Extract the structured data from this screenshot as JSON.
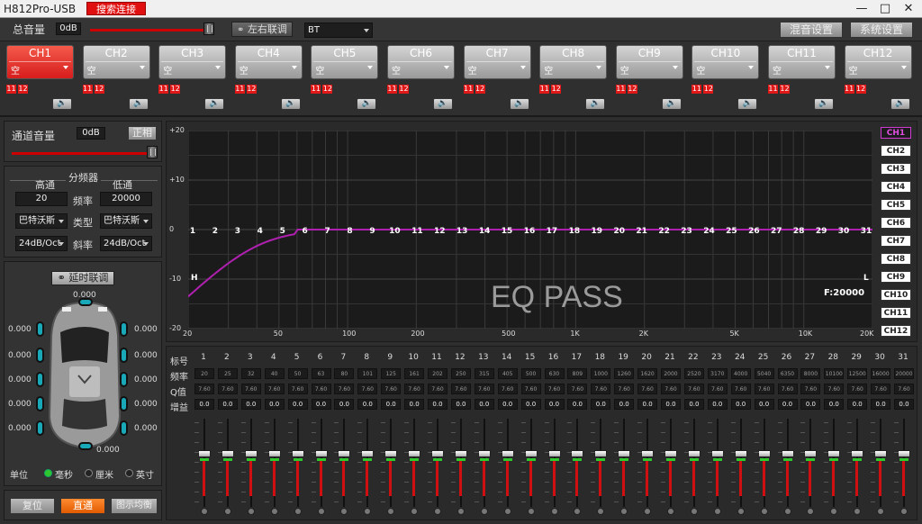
{
  "window": {
    "title": "H812Pro-USB",
    "connect_label": "搜索连接",
    "minimize": "—",
    "maximize": "□",
    "close": "✕"
  },
  "top": {
    "master_label": "总音量",
    "master_value": "0dB",
    "link_label": "左右联调",
    "source_value": "BT",
    "mix_label": "混音设置",
    "system_label": "系统设置"
  },
  "channels": [
    {
      "name": "CH1",
      "sub": "空",
      "active": true
    },
    {
      "name": "CH2",
      "sub": "空",
      "active": false
    },
    {
      "name": "CH3",
      "sub": "空",
      "active": false
    },
    {
      "name": "CH4",
      "sub": "空",
      "active": false
    },
    {
      "name": "CH5",
      "sub": "空",
      "active": false
    },
    {
      "name": "CH6",
      "sub": "空",
      "active": false
    },
    {
      "name": "CH7",
      "sub": "空",
      "active": false
    },
    {
      "name": "CH8",
      "sub": "空",
      "active": false
    },
    {
      "name": "CH9",
      "sub": "空",
      "active": false
    },
    {
      "name": "CH10",
      "sub": "空",
      "active": false
    },
    {
      "name": "CH11",
      "sub": "空",
      "active": false
    },
    {
      "name": "CH12",
      "sub": "空",
      "active": false
    }
  ],
  "channel_tags": [
    "11",
    "12"
  ],
  "channel_volume": {
    "label": "通道音量",
    "value": "0dB",
    "phase_label": "正相"
  },
  "crossover": {
    "title": "分频器",
    "highpass_label": "高通",
    "lowpass_label": "低通",
    "freq_label": "频率",
    "type_label": "类型",
    "slope_label": "斜率",
    "hp_freq": "20",
    "lp_freq": "20000",
    "hp_type": "巴特沃斯",
    "lp_type": "巴特沃斯",
    "hp_slope": "24dB/Oct",
    "lp_slope": "24dB/Oct"
  },
  "delay": {
    "link_label": "延时联调",
    "top_value": "0.000",
    "bottom_value": "0.000",
    "left_values": [
      "0.000",
      "0.000",
      "0.000",
      "0.000",
      "0.000"
    ],
    "right_values": [
      "0.000",
      "0.000",
      "0.000",
      "0.000",
      "0.000"
    ],
    "unit_label": "单位",
    "units": [
      "毫秒",
      "厘米",
      "英寸"
    ],
    "selected_unit": "毫秒"
  },
  "bottom_buttons": {
    "reset": "复位",
    "bypass": "直通",
    "show_eq": "图示均衡"
  },
  "graph": {
    "y_ticks": [
      "+20",
      "+10",
      "0",
      "-10",
      "-20"
    ],
    "x_ticks": [
      "20",
      "50",
      "100",
      "200",
      "500",
      "1K",
      "2K",
      "5K",
      "10K",
      "20K"
    ],
    "band_markers": [
      "1",
      "2",
      "3",
      "4",
      "5",
      "6",
      "7",
      "8",
      "9",
      "10",
      "11",
      "12",
      "13",
      "14",
      "15",
      "16",
      "17",
      "18",
      "19",
      "20",
      "21",
      "22",
      "23",
      "24",
      "25",
      "26",
      "27",
      "28",
      "29",
      "30",
      "31"
    ],
    "watermark": "EQ PASS",
    "freq_readout": "F:20000",
    "h_marker": "H",
    "l_marker": "L",
    "curve_color": "#b020b0",
    "channel_buttons": [
      "CH1",
      "CH2",
      "CH3",
      "CH4",
      "CH5",
      "CH6",
      "CH7",
      "CH8",
      "CH9",
      "CH10",
      "CH11",
      "CH12"
    ],
    "selected_channel": "CH1"
  },
  "eq": {
    "row_labels": {
      "band": "标号",
      "freq": "频率",
      "q": "Q值",
      "gain": "增益"
    },
    "bands": [
      "1",
      "2",
      "3",
      "4",
      "5",
      "6",
      "7",
      "8",
      "9",
      "10",
      "11",
      "12",
      "13",
      "14",
      "15",
      "16",
      "17",
      "18",
      "19",
      "20",
      "21",
      "22",
      "23",
      "24",
      "25",
      "26",
      "27",
      "28",
      "29",
      "30",
      "31"
    ],
    "freqs": [
      "20",
      "25",
      "32",
      "40",
      "50",
      "63",
      "80",
      "101",
      "125",
      "161",
      "202",
      "250",
      "315",
      "405",
      "500",
      "630",
      "809",
      "1000",
      "1260",
      "1620",
      "2000",
      "2520",
      "3170",
      "4000",
      "5040",
      "6350",
      "8000",
      "10100",
      "12500",
      "16000",
      "20000"
    ],
    "q": [
      "7.60",
      "7.60",
      "7.60",
      "7.60",
      "7.60",
      "7.60",
      "7.60",
      "7.60",
      "7.60",
      "7.60",
      "7.60",
      "7.60",
      "7.60",
      "7.60",
      "7.60",
      "7.60",
      "7.60",
      "7.60",
      "7.60",
      "7.60",
      "7.60",
      "7.60",
      "7.60",
      "7.60",
      "7.60",
      "7.60",
      "7.60",
      "7.60",
      "7.60",
      "7.60",
      "7.60"
    ],
    "gain": [
      "0.0",
      "0.0",
      "0.0",
      "0.0",
      "0.0",
      "0.0",
      "0.0",
      "0.0",
      "0.0",
      "0.0",
      "0.0",
      "0.0",
      "0.0",
      "0.0",
      "0.0",
      "0.0",
      "0.0",
      "0.0",
      "0.0",
      "0.0",
      "0.0",
      "0.0",
      "0.0",
      "0.0",
      "0.0",
      "0.0",
      "0.0",
      "0.0",
      "0.0",
      "0.0",
      "0.0"
    ]
  }
}
